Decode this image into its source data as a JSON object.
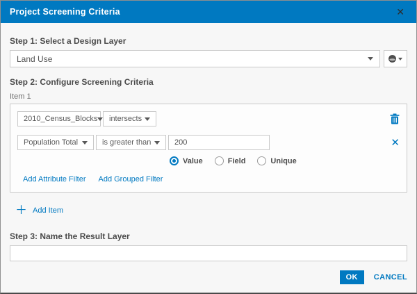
{
  "dialog": {
    "title": "Project Screening Criteria",
    "accent_color": "#0079c1"
  },
  "step1": {
    "label": "Step 1: Select a Design Layer",
    "layer_select": {
      "value": "Land Use"
    }
  },
  "step2": {
    "label": "Step 2: Configure Screening Criteria",
    "item_label": "Item 1",
    "layer_filter": {
      "layer": "2010_Census_Blocks",
      "operator": "intersects"
    },
    "attribute_filter": {
      "field": "Population Total",
      "operator": "is greater than",
      "value": "200"
    },
    "value_type_options": [
      {
        "label": "Value",
        "selected": true
      },
      {
        "label": "Field",
        "selected": false
      },
      {
        "label": "Unique",
        "selected": false
      }
    ],
    "links": {
      "add_attribute_filter": "Add Attribute Filter",
      "add_grouped_filter": "Add Grouped Filter"
    },
    "add_item_label": "Add Item"
  },
  "step3": {
    "label": "Step 3: Name the Result Layer",
    "input_value": ""
  },
  "footer": {
    "ok_label": "OK",
    "cancel_label": "CANCEL"
  }
}
